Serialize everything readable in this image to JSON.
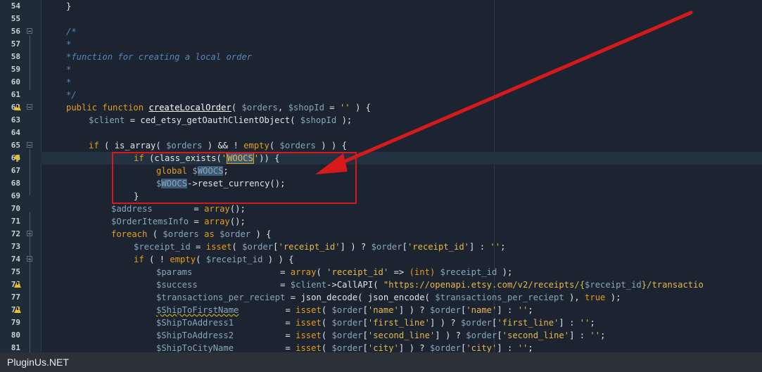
{
  "footer": {
    "watermark": "PluginUs.NET"
  },
  "gutter": {
    "line_numbers": [
      "54",
      "55",
      "56",
      "57",
      "58",
      "59",
      "60",
      "61",
      "62",
      "63",
      "64",
      "65",
      "66",
      "67",
      "68",
      "69",
      "70",
      "71",
      "72",
      "73",
      "74",
      "75",
      "76",
      "77",
      "78",
      "79",
      "80",
      "81"
    ]
  },
  "code": {
    "l54": "}",
    "l56": "/*",
    "l57": "*",
    "l58": "*function for creating a local order",
    "l59": "*",
    "l60": "*",
    "l61": "*/",
    "l62_public": "public function ",
    "l62_fn": "createLocalOrder",
    "l62_rest1": "( ",
    "l62_v1": "$orders",
    "l62_rest2": ", ",
    "l62_v2": "$shopId",
    "l62_rest3": " = ",
    "l62_str": "''",
    "l62_rest4": " ) {",
    "l63_v": "$client",
    "l63_rest": " = ced_etsy_getOauthClientObject( ",
    "l63_v2": "$shopId",
    "l63_end": " );",
    "l65_if": "if",
    "l65_a": " ( is_array( ",
    "l65_v": "$orders",
    "l65_b": " ) && ! ",
    "l65_empty": "empty",
    "l65_c": "( ",
    "l65_v2": "$orders",
    "l65_d": " ) ) {",
    "l66_if": "if",
    "l66_a": " (class_exists(",
    "l66_q1": "'",
    "l66_hl": "WOOCS",
    "l66_q2": "'",
    "l66_b": ")) {",
    "l67_global": "global ",
    "l67_d": "$",
    "l67_hl": "WOOCS",
    "l67_end": ";",
    "l68_d": "$",
    "l68_hl": "WOOCS",
    "l68_end": "->reset_currency();",
    "l69": "}",
    "l70_v": "$address",
    "l70_a": "        = ",
    "l70_arr": "array",
    "l70_b": "();",
    "l71_v": "$OrderItemsInfo",
    "l71_a": " = ",
    "l71_arr": "array",
    "l71_b": "();",
    "l72_kw": "foreach",
    "l72_a": " ( ",
    "l72_v": "$orders",
    "l72_as": " as ",
    "l72_v2": "$order",
    "l72_b": " ) {",
    "l73_v": "$receipt_id",
    "l73_a": " = ",
    "l73_isset": "isset",
    "l73_b": "( ",
    "l73_v2": "$order",
    "l73_c": "[",
    "l73_s1": "'receipt_id'",
    "l73_d": "] ) ? ",
    "l73_v3": "$order",
    "l73_e": "[",
    "l73_s2": "'receipt_id'",
    "l73_f": "] : ",
    "l73_s3": "''",
    "l73_g": ";",
    "l74_if": "if",
    "l74_a": " ( ! ",
    "l74_empty": "empty",
    "l74_b": "( ",
    "l74_v": "$receipt_id",
    "l74_c": " ) ) {",
    "l75_v": "$params",
    "l75_a": "                 = ",
    "l75_arr": "array",
    "l75_b": "( ",
    "l75_s": "'receipt_id'",
    "l75_c": " => ",
    "l75_int": "(int)",
    "l75_d": " ",
    "l75_v2": "$receipt_id",
    "l75_e": " );",
    "l76_v": "$success",
    "l76_a": "                = ",
    "l76_v2": "$client",
    "l76_b": "->CallAPI( ",
    "l76_s": "\"https://openapi.etsy.com/v2/receipts/{",
    "l76_v3": "$receipt_id",
    "l76_s2": "}/transactio",
    "l77_v": "$transactions_per_reciept",
    "l77_a": " = json_decode( json_encode( ",
    "l77_v2": "$transactions_per_reciept",
    "l77_b": " ), ",
    "l77_true": "true",
    "l77_c": " );",
    "l78_v": "$ShipToFirstName",
    "l78_a": "         = ",
    "l78_isset": "isset",
    "l78_b": "( ",
    "l78_v2": "$order",
    "l78_c": "[",
    "l78_s1": "'name'",
    "l78_d": "] ) ? ",
    "l78_v3": "$order",
    "l78_e": "[",
    "l78_s2": "'name'",
    "l78_f": "] : ",
    "l78_s3": "''",
    "l78_g": ";",
    "l79_v": "$ShipToAddress1",
    "l79_a": "          = ",
    "l79_isset": "isset",
    "l79_b": "( ",
    "l79_v2": "$order",
    "l79_c": "[",
    "l79_s1": "'first_line'",
    "l79_d": "] ) ? ",
    "l79_v3": "$order",
    "l79_e": "[",
    "l79_s2": "'first_line'",
    "l79_f": "] : ",
    "l79_s3": "''",
    "l79_g": ";",
    "l80_v": "$ShipToAddress2",
    "l80_a": "          = ",
    "l80_isset": "isset",
    "l80_b": "( ",
    "l80_v2": "$order",
    "l80_c": "[",
    "l80_s1": "'second_line'",
    "l80_d": "] ) ? ",
    "l80_v3": "$order",
    "l80_e": "[",
    "l80_s2": "'second_line'",
    "l80_f": "] : ",
    "l80_s3": "''",
    "l80_g": ";",
    "l81_v": "$ShipToCityName",
    "l81_a": "          = ",
    "l81_isset": "isset",
    "l81_b": "( ",
    "l81_v2": "$order",
    "l81_c": "[",
    "l81_s1": "'city'",
    "l81_d": "] ) ? ",
    "l81_v3": "$order",
    "l81_e": "[",
    "l81_s2": "'city'",
    "l81_f": "] : ",
    "l81_s3": "''",
    "l81_g": ";"
  },
  "colors": {
    "annotation": "#d7191c",
    "keyword": "#e69d1c",
    "comment": "#5b84b7",
    "variable": "#8aa5bb",
    "string": "#e6b84b"
  }
}
